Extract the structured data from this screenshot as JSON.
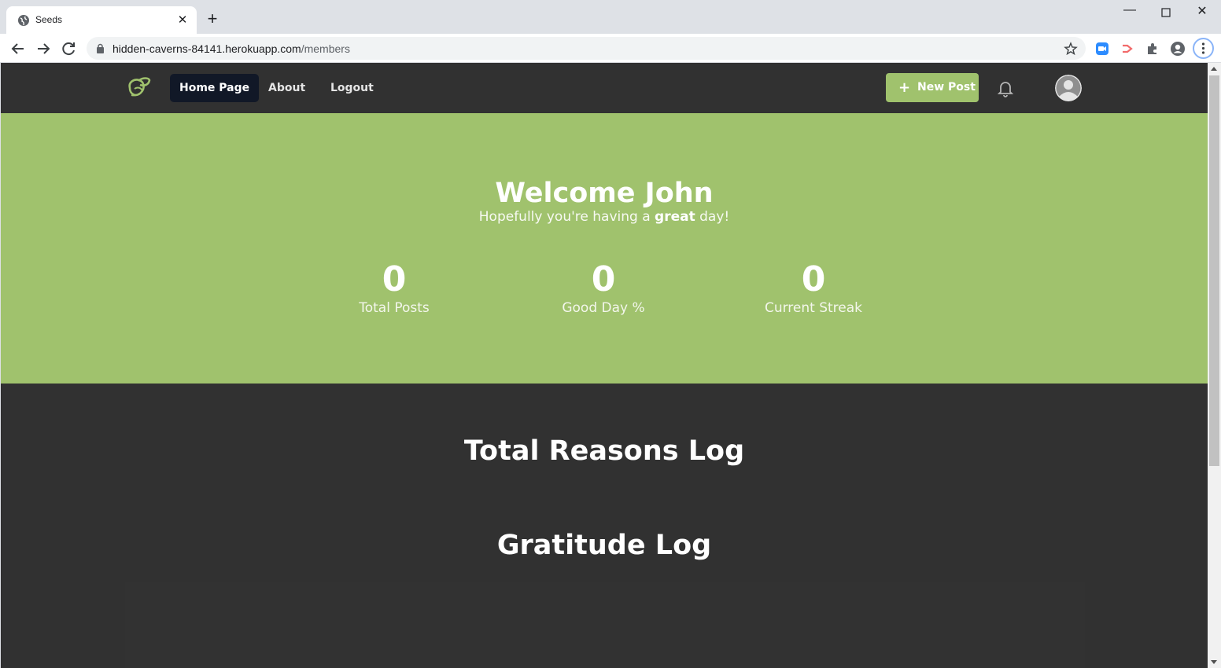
{
  "browser": {
    "tab_title": "Seeds",
    "url_host": "hidden-caverns-84141.herokuapp.com",
    "url_path": "/members"
  },
  "nav": {
    "links": [
      "Home Page",
      "About",
      "Logout"
    ],
    "new_post_label": "New Post"
  },
  "hero": {
    "welcome": "Welcome John",
    "subtitle_before": "Hopefully you're having a ",
    "subtitle_bold": "great",
    "subtitle_after": " day!",
    "stats": [
      {
        "value": "0",
        "label": "Total Posts"
      },
      {
        "value": "0",
        "label": "Good Day %"
      },
      {
        "value": "0",
        "label": "Current Streak"
      }
    ]
  },
  "sections": {
    "reasons_title": "Total Reasons Log",
    "gratitude_title": "Gratitude Log"
  },
  "colors": {
    "brand_green": "#a0c26d",
    "dark_bg": "#313131",
    "active_nav": "#111827"
  }
}
